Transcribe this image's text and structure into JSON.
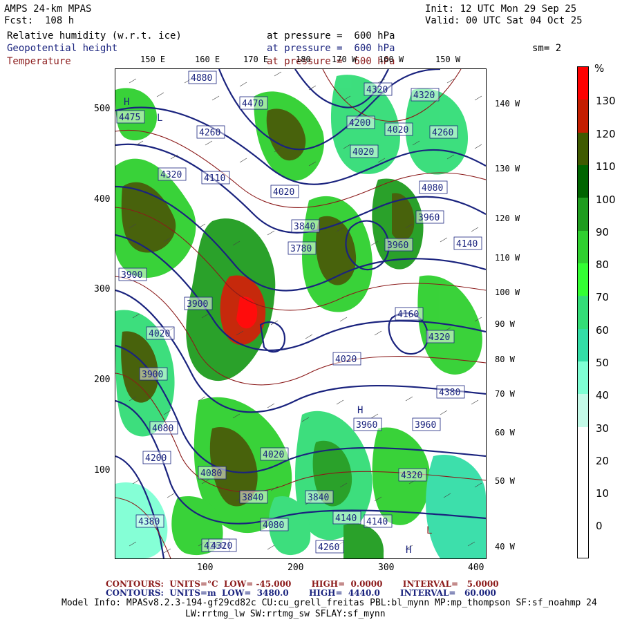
{
  "header": {
    "model": "AMPS 24-km MPAS",
    "fcst": "Fcst:  108 h",
    "init": "Init: 12 UTC Mon 29 Sep 25",
    "valid": "Valid: 00 UTC Sat 04 Oct 25",
    "field1": "Relative humidity (w.r.t. ice)",
    "field2": "Geopotential height",
    "field3": "Temperature",
    "pressure1": "at pressure =  600 hPa",
    "pressure2": "at pressure =  600 hPa",
    "pressure3": "at pressure =  600 hPa",
    "smooth": "sm= 2"
  },
  "axes": {
    "x_ticks": [
      "100",
      "200",
      "300",
      "400"
    ],
    "y_ticks": [
      "500",
      "400",
      "300",
      "200",
      "100"
    ],
    "lon_top": [
      "150 E",
      "160 E",
      "170 E",
      "180",
      "170 W",
      "160 W",
      "150 W"
    ],
    "lon_right": [
      "140 W",
      "130 W",
      "120 W",
      "110 W",
      "100 W",
      "90 W",
      "80 W",
      "70 W",
      "60 W",
      "50 W",
      "40 W"
    ]
  },
  "colorbar": {
    "unit": "%",
    "labels": [
      "130",
      "120",
      "110",
      "100",
      "90",
      "80",
      "70",
      "60",
      "50",
      "40",
      "30",
      "20",
      "10",
      "0"
    ],
    "colors": [
      "#ff0000",
      "#c41e00",
      "#3f5a00",
      "#006400",
      "#1f9c1f",
      "#2fd02f",
      "#33ff33",
      "#33dd77",
      "#33dda6",
      "#7fffd4",
      "#c4fae8",
      "#ffffff",
      "#ffffff",
      "#ffffff",
      "#ffffff"
    ]
  },
  "height_labels": [
    "4880",
    "4470",
    "4320",
    "4320",
    "4260",
    "4200",
    "4020",
    "4020",
    "4260",
    "4320",
    "4110",
    "4020",
    "3960",
    "4080",
    "3960",
    "4140",
    "3780",
    "3840",
    "3900",
    "4020",
    "3900",
    "4160",
    "4320",
    "4380",
    "4380",
    "4320",
    "4080",
    "4200",
    "4260",
    "3900",
    "4020",
    "4080",
    "3840",
    "3960",
    "4140",
    "4080",
    "4320",
    "4260",
    "3840",
    "4020",
    "3960",
    "4140",
    "4475"
  ],
  "footer": {
    "temp_contours": "CONTOURS:  UNITS=°C  LOW= -45.000       HIGH=  0.0000       INTERVAL=   5.0000",
    "height_contours": "CONTOURS:  UNITS=m  LOW=  3480.0       HIGH=  4440.0       INTERVAL=   60.000",
    "model_info": "Model Info: MPASv8.2.3-194-gf29cd82c CU:cu_grell_freitas PBL:bl_mynn MP:mp_thompson SF:sf_noahmp 24",
    "model_info2": "LW:rrtmg_lw SW:rrtmg_sw SFLAY:sf_mynn"
  }
}
